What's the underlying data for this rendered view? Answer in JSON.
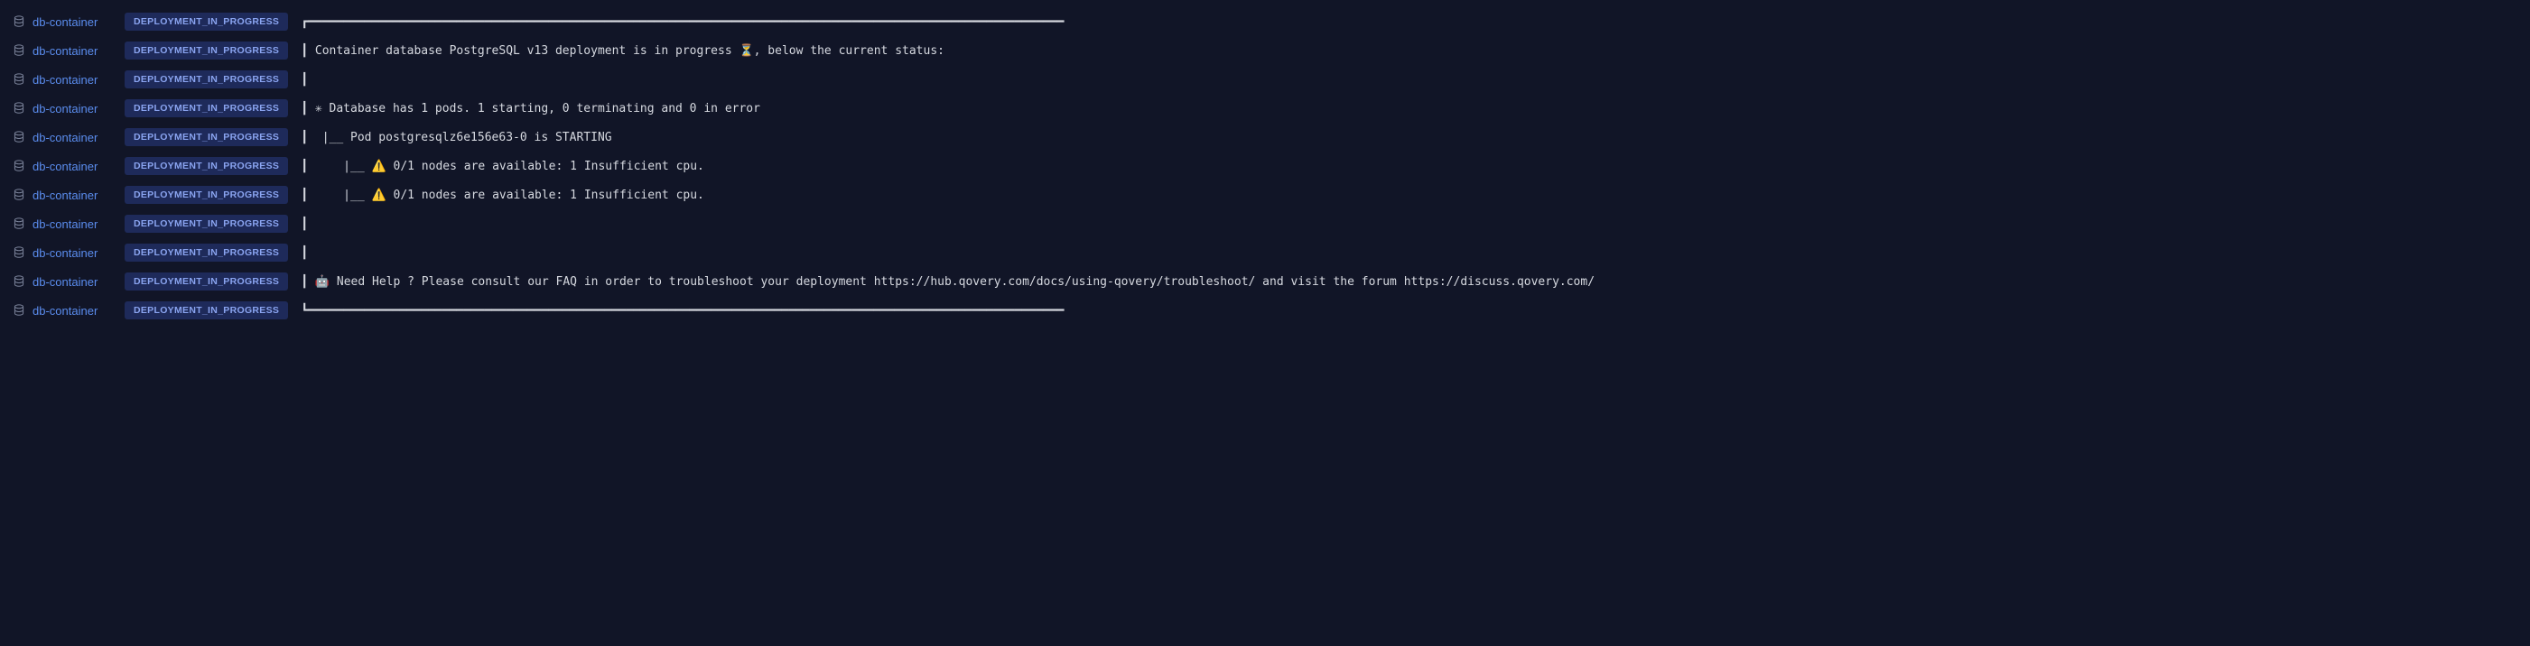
{
  "source_label": "db-container",
  "badge_label": "DEPLOYMENT_IN_PROGRESS",
  "logs": [
    {
      "msg": "┏━━━━━━━━━━━━━━━━━━━━━━━━━━━━━━━━━━━━━━━━━━━━━━━━━━━━━━━━━━━━━━━━━━━━━━━━━━━━━━━━━━━━━━━━━━━━━━━━━━━━━━━━━━━"
    },
    {
      "msg": "┃ Container database PostgreSQL v13 deployment is in progress ⏳, below the current status:"
    },
    {
      "msg": "┃"
    },
    {
      "msg": "┃ ✳ Database has 1 pods. 1 starting, 0 terminating and 0 in error"
    },
    {
      "msg": "┃  |__ Pod postgresqlz6e156e63-0 is STARTING"
    },
    {
      "msg": "┃     |__ ⚠️ 0/1 nodes are available: 1 Insufficient cpu."
    },
    {
      "msg": "┃     |__ ⚠️ 0/1 nodes are available: 1 Insufficient cpu."
    },
    {
      "msg": "┃"
    },
    {
      "msg": "┃"
    },
    {
      "msg": "┃ 🤖 Need Help ? Please consult our FAQ in order to troubleshoot your deployment https://hub.qovery.com/docs/using-qovery/troubleshoot/ and visit the forum https://discuss.qovery.com/"
    },
    {
      "msg": "┗━━━━━━━━━━━━━━━━━━━━━━━━━━━━━━━━━━━━━━━━━━━━━━━━━━━━━━━━━━━━━━━━━━━━━━━━━━━━━━━━━━━━━━━━━━━━━━━━━━━━━━━━━━━"
    }
  ]
}
